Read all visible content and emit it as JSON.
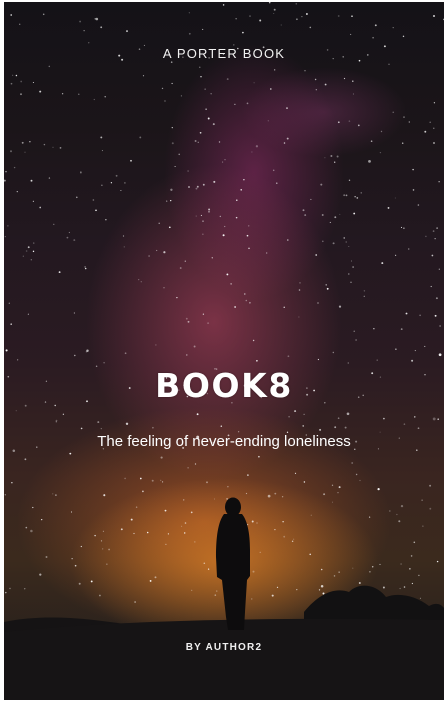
{
  "cover": {
    "publisher": "A PORTER BOOK",
    "title": "BOOK8",
    "subtitle": "The feeling of never-ending loneliness",
    "author": "BY AUTHOR2"
  },
  "colors": {
    "background": "#1b1519",
    "glow_warm": "#e07a2a",
    "glow_magenta": "#b04678",
    "text": "#ffffff"
  }
}
